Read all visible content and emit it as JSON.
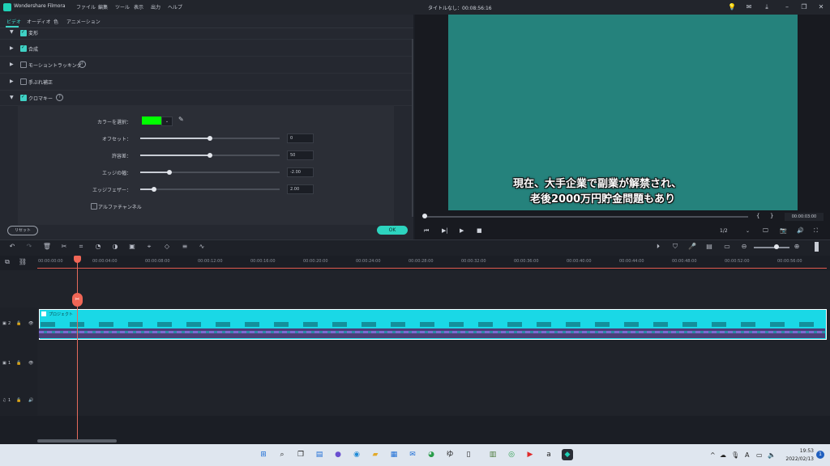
{
  "app": {
    "name": "Wondershare Filmora",
    "doc_title": "タイトルなし：00:08:56:16"
  },
  "menu": [
    "ファイル",
    "編集",
    "ツール",
    "表示",
    "出力",
    "ヘルプ"
  ],
  "tabs": [
    "ビデオ",
    "オーディオ",
    "色",
    "アニメーション"
  ],
  "properties": {
    "rows": [
      {
        "label": "変形",
        "checked": true
      },
      {
        "label": "合成",
        "checked": true
      },
      {
        "label": "モーショントラッキング",
        "checked": false
      },
      {
        "label": "手ぶれ補正",
        "checked": false
      },
      {
        "label": "クロマキー",
        "checked": true
      }
    ],
    "chroma": {
      "color_label": "カラーを選択：",
      "key_color": "#00ff00",
      "params": [
        {
          "label": "オフセット：",
          "value": "0",
          "level": 0.5
        },
        {
          "label": "許容差：",
          "value": "50",
          "level": 0.5
        },
        {
          "label": "エッジの幅：",
          "value": "-2.00",
          "level": 0.2
        },
        {
          "label": "エッジフェザー：",
          "value": "2.00",
          "level": 0.1
        }
      ],
      "alpha_label": "アルファチャンネル"
    },
    "reset_label": "リセット",
    "ok_label": "OK"
  },
  "preview": {
    "background": "#25827c",
    "subtitle_line1": "現在、大手企業で副業が解禁され、",
    "subtitle_line2": "老後2000万円貯金問題もあり",
    "timecode": "00:00:03:00",
    "ratio": "1/2",
    "progress": 0.0
  },
  "ruler_ticks": [
    "00:00:00:00",
    "00:00:04:00",
    "00:00:08:00",
    "00:00:12:00",
    "00:00:16:00",
    "00:00:20:00",
    "00:00:24:00",
    "00:00:28:00",
    "00:00:32:00",
    "00:00:36:00",
    "00:00:40:00",
    "00:00:44:00",
    "00:00:48:00",
    "00:00:52:00",
    "00:00:56:00"
  ],
  "timeline": {
    "clip_title": "プロジェクト",
    "tracks": [
      {
        "label": "2",
        "type": "video"
      },
      {
        "label": "1",
        "type": "video"
      },
      {
        "label": "1",
        "type": "audio"
      }
    ]
  },
  "taskbar": {
    "time": "19:53",
    "date": "2022/02/13",
    "notifications": "1",
    "ime": "A"
  },
  "colors": {
    "accent": "#3fd1c4",
    "playhead": "#f06656",
    "clip": "#1ad8e6"
  }
}
